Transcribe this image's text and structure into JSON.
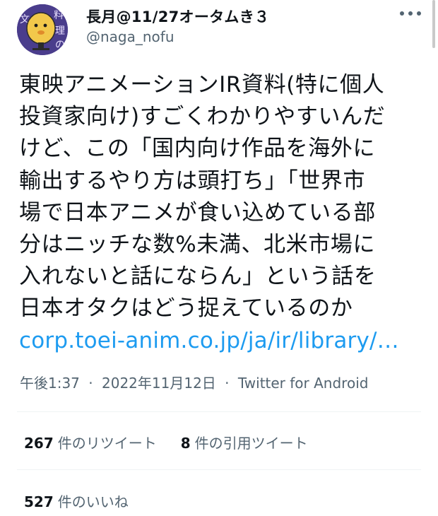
{
  "author": {
    "display_name": "長月@11/27オータムき３",
    "handle": "@naga_nofu"
  },
  "icons": {
    "avatar": "avatar-potato-character",
    "more": "more-dots-icon"
  },
  "tweet": {
    "lines": [
      "東映アニメーションIR資料(特に個人",
      "投資家向け)すごくわかりやすいんだ",
      "けど、この「国内向け作品を海外に",
      "輸出するやり方は頭打ち」「世界市",
      "場で日本アニメが食い込めている部",
      "分はニッチな数%未満、北米市場に",
      "入れないと話にならん」という話を",
      "日本オタクはどう捉えているのか"
    ],
    "link": "corp.toei-anim.co.jp/ja/ir/library/…"
  },
  "meta": {
    "time": "午後1:37",
    "date": "2022年11月12日",
    "source": "Twitter for Android",
    "separator": "·"
  },
  "stats": {
    "retweets_count": "267",
    "retweets_label": "件のリツイート",
    "quotes_count": "8",
    "quotes_label": "件の引用ツイート",
    "likes_count": "527",
    "likes_label": "件のいいね"
  },
  "colors": {
    "text": "#0f1419",
    "secondary": "#536471",
    "link": "#1d9bf0",
    "divider": "#eff3f4"
  }
}
